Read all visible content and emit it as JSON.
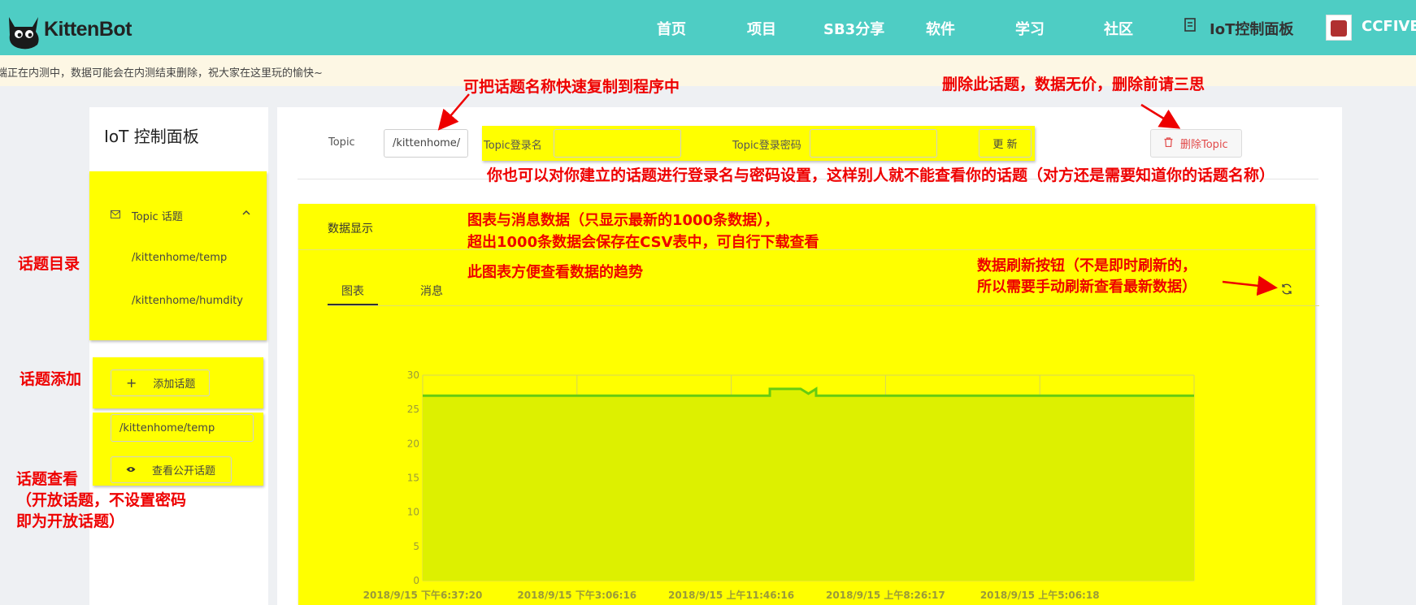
{
  "nav": {
    "brand": "KittenBot",
    "items": [
      "首页",
      "项目",
      "SB3分享",
      "软件",
      "学习",
      "社区"
    ],
    "iot": "IoT控制面板",
    "user": "CCFIVE"
  },
  "notice": "端正在内测中，数据可能会在内测结束删除，祝大家在这里玩的愉快~",
  "sidebar": {
    "title": "IoT 控制面板",
    "group": "Topic 话题",
    "topics": [
      "/kittenhome/temp",
      "/kittenhome/humdity"
    ],
    "add_label": "添加话题",
    "search_value": "/kittenhome/temp",
    "view_label": "查看公开话题"
  },
  "topbar": {
    "topic_label": "Topic",
    "topic_value": "/kittenhome/",
    "login_label": "Topic登录名",
    "password_label": "Topic登录密码",
    "update_label": "更 新",
    "delete_label": "删除Topic"
  },
  "panel": {
    "title": "数据显示",
    "tabs": [
      "图表",
      "消息"
    ]
  },
  "annotations": {
    "copy_topic": "可把话题名称快速复制到程序中",
    "delete_topic": "删除此话题，数据无价，删除前请三思",
    "login_settings": "你也可以对你建立的话题进行登录名与密码设置，这样别人就不能查看你的话题（对方还是需要知道你的话题名称）",
    "chart_info_1": "图表与消息数据（只显示最新的1000条数据），",
    "chart_info_2": "超出1000条数据会保存在CSV表中，可自行下载查看",
    "chart_trend": "此图表方便查看数据的趋势",
    "refresh_1": "数据刷新按钮（不是即时刷新的，",
    "refresh_2": "所以需要手动刷新查看最新数据）",
    "topic_dir": "话题目录",
    "topic_add": "话题添加",
    "topic_view_1": "话题查看",
    "topic_view_2": "（开放话题，不设置密码",
    "topic_view_3": "即为开放话题）"
  },
  "chart_data": {
    "type": "area",
    "x": [
      "2018/9/15 下午6:37:20",
      "2018/9/15 下午3:06:16",
      "2018/9/15 上午11:46:16",
      "2018/9/15 上午8:26:17",
      "2018/9/15 上午5:06:18"
    ],
    "series": [
      {
        "values": [
          27,
          27,
          27,
          27,
          28,
          28,
          27.3,
          28,
          27,
          27,
          27,
          27
        ]
      }
    ],
    "ylim": [
      0,
      30
    ],
    "yticks": [
      0,
      5,
      10,
      15,
      20,
      25,
      30
    ],
    "grid": true,
    "colors": {
      "line": "#66cc11",
      "fill": "#ddf000",
      "text": "#9a9a3a"
    }
  }
}
